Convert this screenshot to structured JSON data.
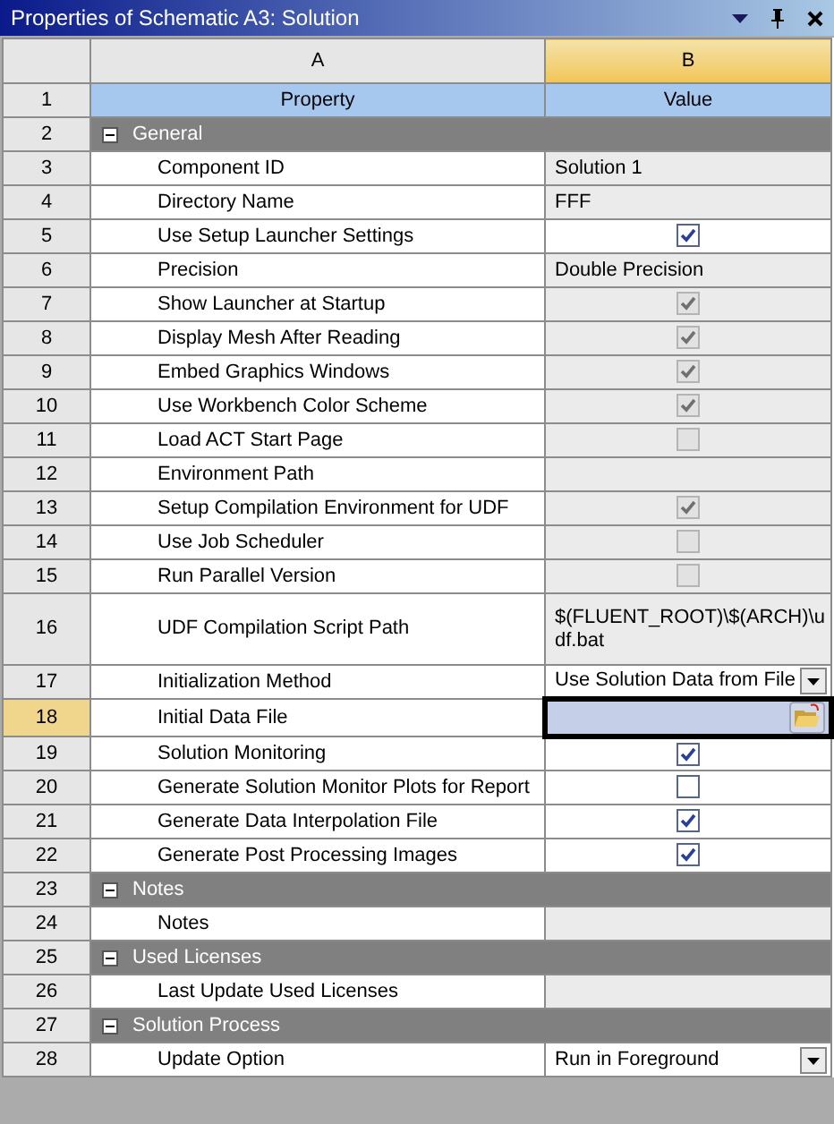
{
  "window": {
    "title": "Properties of Schematic A3: Solution"
  },
  "columns": [
    {
      "label": "A",
      "selected": false
    },
    {
      "label": "B",
      "selected": true
    }
  ],
  "header": {
    "num": "1",
    "property": "Property",
    "value": "Value"
  },
  "rows": [
    {
      "num": "2",
      "kind": "section",
      "label": "General",
      "expanded": true,
      "selected": false
    },
    {
      "num": "3",
      "kind": "property",
      "label": "Component ID",
      "selected": false,
      "value": {
        "kind": "text",
        "text": "Solution 1",
        "disabled": true
      }
    },
    {
      "num": "4",
      "kind": "property",
      "label": "Directory Name",
      "selected": false,
      "value": {
        "kind": "text",
        "text": "FFF",
        "disabled": true
      }
    },
    {
      "num": "5",
      "kind": "property",
      "label": "Use Setup Launcher Settings",
      "selected": false,
      "value": {
        "kind": "checkbox",
        "checked": true,
        "disabled": false
      }
    },
    {
      "num": "6",
      "kind": "property",
      "label": "Precision",
      "selected": false,
      "value": {
        "kind": "text",
        "text": "Double Precision",
        "disabled": true
      }
    },
    {
      "num": "7",
      "kind": "property",
      "label": "Show Launcher at Startup",
      "selected": false,
      "value": {
        "kind": "checkbox",
        "checked": true,
        "disabled": true
      }
    },
    {
      "num": "8",
      "kind": "property",
      "label": "Display Mesh After Reading",
      "selected": false,
      "value": {
        "kind": "checkbox",
        "checked": true,
        "disabled": true
      }
    },
    {
      "num": "9",
      "kind": "property",
      "label": "Embed Graphics Windows",
      "selected": false,
      "value": {
        "kind": "checkbox",
        "checked": true,
        "disabled": true
      }
    },
    {
      "num": "10",
      "kind": "property",
      "label": "Use Workbench Color Scheme",
      "selected": false,
      "value": {
        "kind": "checkbox",
        "checked": true,
        "disabled": true
      }
    },
    {
      "num": "11",
      "kind": "property",
      "label": "Load ACT Start Page",
      "selected": false,
      "value": {
        "kind": "checkbox",
        "checked": false,
        "disabled": true
      }
    },
    {
      "num": "12",
      "kind": "property",
      "label": "Environment Path",
      "selected": false,
      "value": {
        "kind": "empty",
        "disabled": true
      }
    },
    {
      "num": "13",
      "kind": "property",
      "label": "Setup Compilation Environment for UDF",
      "selected": false,
      "value": {
        "kind": "checkbox",
        "checked": true,
        "disabled": true
      }
    },
    {
      "num": "14",
      "kind": "property",
      "label": "Use Job Scheduler",
      "selected": false,
      "value": {
        "kind": "checkbox",
        "checked": false,
        "disabled": true
      }
    },
    {
      "num": "15",
      "kind": "property",
      "label": "Run Parallel Version",
      "selected": false,
      "value": {
        "kind": "checkbox",
        "checked": false,
        "disabled": true
      }
    },
    {
      "num": "16",
      "kind": "property",
      "label": "UDF Compilation Script Path",
      "selected": false,
      "value": {
        "kind": "text",
        "text": "$(FLUENT_ROOT)\\$(ARCH)\\udf.bat",
        "disabled": true
      }
    },
    {
      "num": "17",
      "kind": "property",
      "label": "Initialization Method",
      "selected": false,
      "value": {
        "kind": "dropdown",
        "text": "Use Solution Data from File",
        "disabled": false
      }
    },
    {
      "num": "18",
      "kind": "property",
      "label": "Initial Data File",
      "selected": true,
      "value": {
        "kind": "file",
        "disabled": false
      }
    },
    {
      "num": "19",
      "kind": "property",
      "label": "Solution Monitoring",
      "selected": false,
      "value": {
        "kind": "checkbox",
        "checked": true,
        "disabled": false
      }
    },
    {
      "num": "20",
      "kind": "property",
      "label": "Generate Solution Monitor Plots for Report",
      "selected": false,
      "value": {
        "kind": "checkbox",
        "checked": false,
        "disabled": false
      }
    },
    {
      "num": "21",
      "kind": "property",
      "label": "Generate Data Interpolation File",
      "selected": false,
      "value": {
        "kind": "checkbox",
        "checked": true,
        "disabled": false
      }
    },
    {
      "num": "22",
      "kind": "property",
      "label": "Generate Post Processing Images",
      "selected": false,
      "value": {
        "kind": "checkbox",
        "checked": true,
        "disabled": false
      }
    },
    {
      "num": "23",
      "kind": "section",
      "label": "Notes",
      "expanded": true,
      "selected": false
    },
    {
      "num": "24",
      "kind": "property",
      "label": "Notes",
      "selected": false,
      "value": {
        "kind": "empty",
        "disabled": true
      }
    },
    {
      "num": "25",
      "kind": "section",
      "label": "Used Licenses",
      "expanded": true,
      "selected": false
    },
    {
      "num": "26",
      "kind": "property",
      "label": "Last Update Used Licenses",
      "selected": false,
      "value": {
        "kind": "empty",
        "disabled": true
      }
    },
    {
      "num": "27",
      "kind": "section",
      "label": "Solution Process",
      "expanded": true,
      "selected": false
    },
    {
      "num": "28",
      "kind": "property",
      "label": "Update Option",
      "selected": false,
      "value": {
        "kind": "dropdown",
        "text": "Run in Foreground",
        "disabled": false
      }
    }
  ]
}
